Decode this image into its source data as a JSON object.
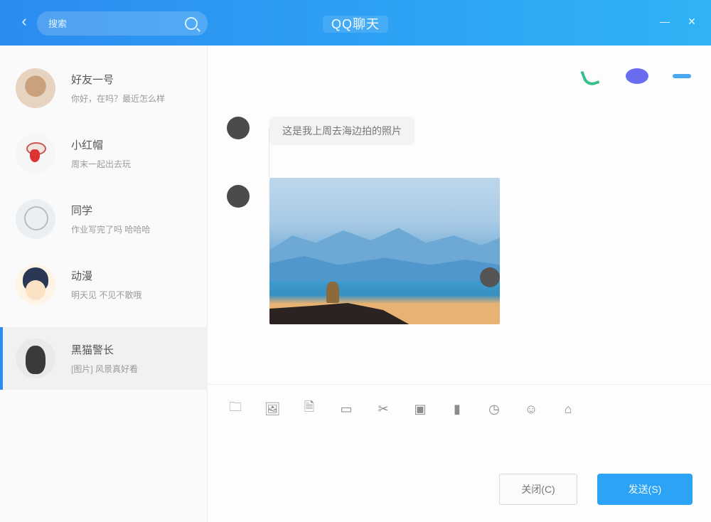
{
  "window": {
    "title": "QQ聊天"
  },
  "search": {
    "placeholder": "搜索"
  },
  "contacts": [
    {
      "name": "好友一号",
      "preview": "你好，在吗？最近怎么样"
    },
    {
      "name": "小红帽",
      "preview": "周末一起出去玩"
    },
    {
      "name": "同学",
      "preview": "作业写完了吗 哈哈哈"
    },
    {
      "name": "动漫",
      "preview": "明天见 不见不散哦"
    },
    {
      "name": "黑猫警长",
      "preview": "[图片] 风景真好看"
    }
  ],
  "chat": {
    "active_contact": "黑猫警长",
    "messages": [
      {
        "type": "text",
        "text": "这是我上周去海边拍的照片"
      },
      {
        "type": "image",
        "alt": "lake-landscape"
      }
    ]
  },
  "toolbar_icons": [
    "folder-icon",
    "image-icon",
    "doc-icon",
    "screen-icon",
    "scissors-icon",
    "bag-icon",
    "mic-icon",
    "history-icon",
    "emoji-icon",
    "gift-icon"
  ],
  "input": {
    "placeholder": ""
  },
  "buttons": {
    "close": "关闭(C)",
    "send": "发送(S)"
  },
  "colors": {
    "accent": "#2b8cf0",
    "send": "#2ca3f5",
    "phone": "#35c08a",
    "video": "#6a6cf0"
  }
}
